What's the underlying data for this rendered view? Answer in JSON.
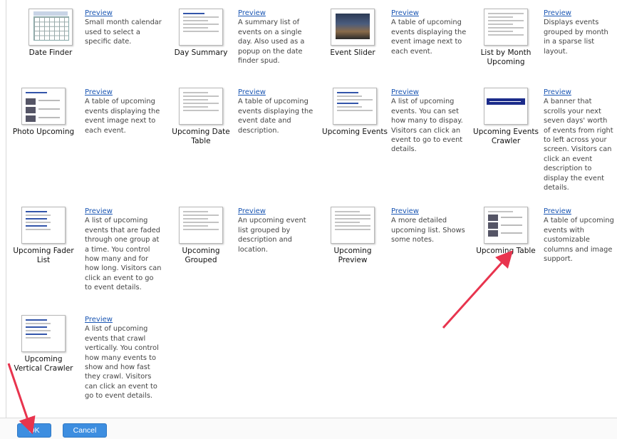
{
  "widgets": [
    {
      "id": "date-finder",
      "label": "Date Finder",
      "preview": "Preview",
      "desc": "Small month calendar used to select a specific date."
    },
    {
      "id": "day-summary",
      "label": "Day Summary",
      "preview": "Preview",
      "desc": "A summary list of events on a single day. Also used as a popup on the date finder spud."
    },
    {
      "id": "event-slider",
      "label": "Event Slider",
      "preview": "Preview",
      "desc": "A table of upcoming events displaying the event image next to each event."
    },
    {
      "id": "list-by-month",
      "label": "List by Month Upcoming",
      "preview": "Preview",
      "desc": "Displays events grouped by month in a sparse list layout."
    },
    {
      "id": "photo-upcoming",
      "label": "Photo Upcoming",
      "preview": "Preview",
      "desc": "A table of upcoming events displaying the event image next to each event."
    },
    {
      "id": "upcoming-date-table",
      "label": "Upcoming Date Table",
      "preview": "Preview",
      "desc": "A table of upcoming events displaying the event date and description."
    },
    {
      "id": "upcoming-events",
      "label": "Upcoming Events",
      "preview": "Preview",
      "desc": "A list of upcoming events. You can set how many to dispay. Visitors can click an event to go to event details."
    },
    {
      "id": "upcoming-events-crawler",
      "label": "Upcoming Events Crawler",
      "preview": "Preview",
      "desc": "A banner that scrolls your next seven days' worth of events from right to left across your screen. Visitors can click an event description to display the event details."
    },
    {
      "id": "upcoming-fader-list",
      "label": "Upcoming Fader List",
      "preview": "Preview",
      "desc": "A list of upcoming events that are faded through one group at a time. You control how many and for how long. Visitors can click an event to go to event details."
    },
    {
      "id": "upcoming-grouped",
      "label": "Upcoming Grouped",
      "preview": "Preview",
      "desc": "An upcoming event list grouped by description and location."
    },
    {
      "id": "upcoming-preview",
      "label": "Upcoming Preview",
      "preview": "Preview",
      "desc": "A more detailed upcoming list. Shows some notes."
    },
    {
      "id": "upcoming-table",
      "label": "Upcoming Table",
      "preview": "Preview",
      "desc": "A table of upcoming events with customizable columns and image support."
    },
    {
      "id": "upcoming-vertical-crawler",
      "label": "Upcoming Vertical Crawler",
      "preview": "Preview",
      "desc": "A list of upcoming events that crawl vertically. You control how many events to show and how fast they crawl. Visitors can click an event to go to event details."
    }
  ],
  "footer": {
    "ok_label": "OK",
    "cancel_label": "Cancel"
  },
  "annotation_color": "#e8344e"
}
